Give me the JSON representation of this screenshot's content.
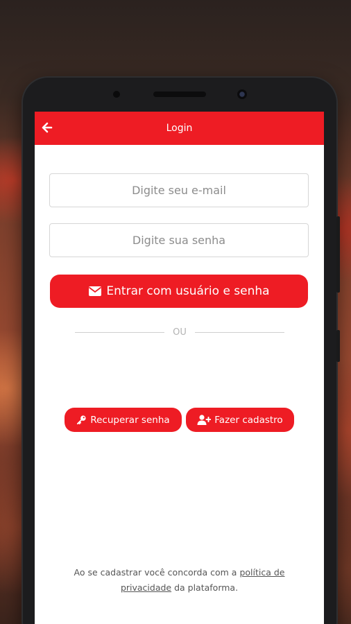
{
  "header": {
    "title": "Login",
    "back_icon": "arrow-left-icon"
  },
  "form": {
    "email_placeholder": "Digite seu e-mail",
    "password_placeholder": "Digite sua senha",
    "login_button_label": "Entrar com usuário e senha",
    "login_button_icon": "envelope-icon"
  },
  "divider": {
    "label": "OU"
  },
  "actions": {
    "recover_label": "Recuperar senha",
    "recover_icon": "key-icon",
    "signup_label": "Fazer cadastro",
    "signup_icon": "user-plus-icon"
  },
  "legal": {
    "prefix": "Ao se cadastrar você concorda com a ",
    "link_text": "política de privacidade",
    "suffix": " da plataforma."
  },
  "colors": {
    "accent": "#ee1c24",
    "background": "#ffffff",
    "border": "#d6d6d6",
    "muted_text": "#8c8c8c"
  }
}
